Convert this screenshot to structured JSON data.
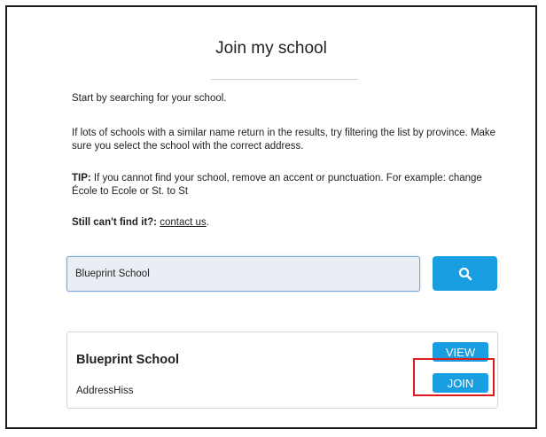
{
  "page": {
    "title": "Join my school"
  },
  "instructions": {
    "intro": "Start by searching for your school.",
    "filter_tip": "If lots of schools with a similar name return in the results, try filtering the list by province. Make sure you select the school with the correct address.",
    "tip_label": "TIP:",
    "tip_text": " If you cannot find your school, remove an accent or punctuation. For example: change École to Ecole or St. to St",
    "still_label": "Still can't find it?:",
    "contact_link": "contact us",
    "contact_suffix": "."
  },
  "search": {
    "value": "Blueprint School",
    "button_icon": "search-icon",
    "button_color": "#1a9ee2"
  },
  "results": [
    {
      "name": "Blueprint School",
      "address": "AddressHiss",
      "view_label": "VIEW",
      "join_label": "JOIN"
    }
  ],
  "colors": {
    "accent": "#1a9ee2",
    "highlight": "#e01b1b"
  }
}
